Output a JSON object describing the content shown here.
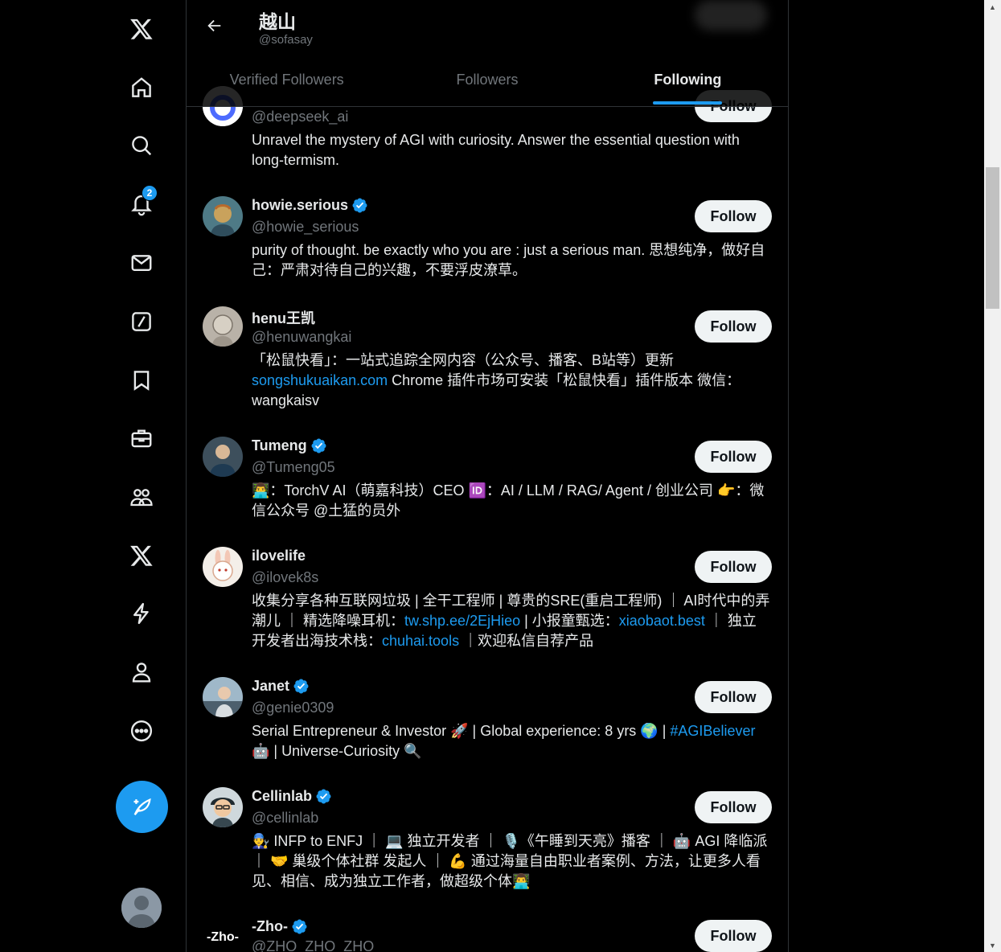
{
  "sidebar": {
    "items": [
      {
        "name": "x-logo-icon"
      },
      {
        "name": "home-icon"
      },
      {
        "name": "search-icon"
      },
      {
        "name": "notifications-icon",
        "badge": "2"
      },
      {
        "name": "messages-icon"
      },
      {
        "name": "grok-icon"
      },
      {
        "name": "bookmarks-icon"
      },
      {
        "name": "jobs-icon"
      },
      {
        "name": "communities-icon"
      },
      {
        "name": "premium-icon"
      },
      {
        "name": "verified-orgs-icon"
      },
      {
        "name": "profile-icon"
      },
      {
        "name": "more-icon"
      }
    ],
    "post_icon": "post-feather-icon"
  },
  "header": {
    "name": "越山",
    "handle": "@sofasay"
  },
  "tabs": [
    {
      "label": "Verified Followers",
      "active": false
    },
    {
      "label": "Followers",
      "active": false
    },
    {
      "label": "Following",
      "active": true
    }
  ],
  "users": [
    {
      "name": "",
      "handle": "@deepseek_ai",
      "verified": false,
      "follow_label": "Follow",
      "bio": "Unravel the mystery of AGI with curiosity. Answer the essential question with long-termism."
    },
    {
      "name": "howie.serious",
      "handle": "@howie_serious",
      "verified": true,
      "follow_label": "Follow",
      "bio": "purity of thought. be exactly who you are : just a serious man. 思想纯净，做好自己：严肃对待自己的兴趣，不要浮皮潦草。"
    },
    {
      "name": "henu王凯",
      "handle": "@henuwangkai",
      "verified": false,
      "follow_label": "Follow",
      "bio_pre": "「松鼠快看」：一站式追踪全网内容（公众号、播客、B站等）更新 ",
      "bio_link": "songshukuaikan.com",
      "bio_post": " Chrome 插件市场可安装「松鼠快看」插件版本 微信：wangkaisv"
    },
    {
      "name": "Tumeng",
      "handle": "@Tumeng05",
      "verified": true,
      "follow_label": "Follow",
      "bio": "👨‍💻：TorchV AI（萌嘉科技）CEO 🆔：AI / LLM / RAG/ Agent / 创业公司 👉：微信公众号 @土猛的员外"
    },
    {
      "name": "ilovelife",
      "handle": "@ilovek8s",
      "verified": false,
      "follow_label": "Follow",
      "bio_1": "收集分享各种互联网垃圾 | 全干工程师 | 尊贵的SRE(重启工程师) ｜ AI时代中的弄潮儿 ｜ 精选降噪耳机：",
      "bio_link_1": "tw.shp.ee/2EjHieo",
      "bio_2": " | 小报童甄选：",
      "bio_link_2": "xiaobaot.best",
      "bio_3": " ｜ 独立开发者出海技术栈：",
      "bio_link_3": "chuhai.tools",
      "bio_4": " ｜欢迎私信自荐产品"
    },
    {
      "name": "Janet",
      "handle": "@genie0309",
      "verified": true,
      "follow_label": "Follow",
      "bio_pre": "Serial Entrepreneur & Investor 🚀 | Global experience: 8 yrs 🌍 | ",
      "bio_link": "#AGIBeliever",
      "bio_post": " 🤖 | Universe-Curiosity 🔍"
    },
    {
      "name": "Cellinlab",
      "handle": "@cellinlab",
      "verified": true,
      "follow_label": "Follow",
      "bio": "👨‍🔧 INFP to ENFJ ｜ 💻 独立开发者 ｜ 🎙️《午睡到天亮》播客 ｜ 🤖 AGI 降临派 ｜ 🤝 巢级个体社群 发起人 ｜ 💪 通过海量自由职业者案例、方法，让更多人看见、相信、成为独立工作者，做超级个体👨‍💻"
    },
    {
      "name": "-Zho-",
      "handle": "@ZHO_ZHO_ZHO",
      "verified": true,
      "follow_label": "Follow",
      "avatar_text": "-Zho-"
    }
  ],
  "colors": {
    "accent": "#1d9bf0",
    "background": "#000000",
    "text": "#e7e9ea",
    "muted": "#71767b",
    "follow_bg": "#eff3f4"
  }
}
